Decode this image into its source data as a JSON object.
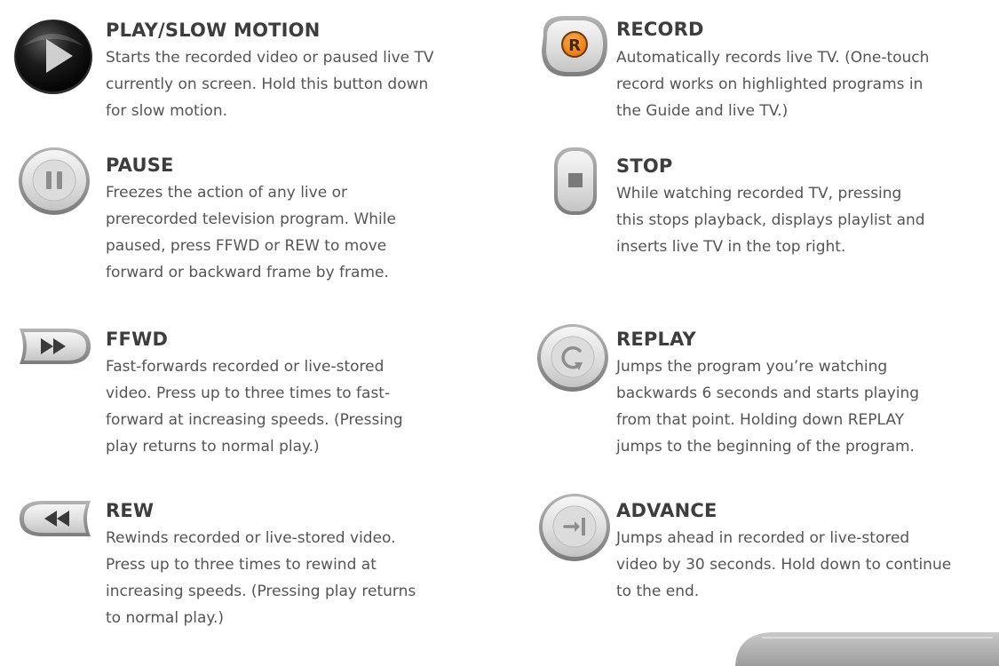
{
  "buttons": [
    {
      "title": "PLAY/SLOW MOTION",
      "icon": "play-icon",
      "lines": [
        "Starts the recorded video or paused live TV",
        "currently on screen. Hold this button down",
        "for slow motion."
      ]
    },
    {
      "title": "PAUSE",
      "icon": "pause-icon",
      "lines": [
        "Freezes the action of any live or",
        "prerecorded television program. While",
        "paused, press FFWD or REW to move",
        "forward or backward frame by frame."
      ]
    },
    {
      "title": "FFWD",
      "icon": "fast-forward-icon",
      "lines": [
        "Fast-forwards recorded or live-stored",
        "video. Press up to three times to fast-",
        "forward at increasing speeds. (Pressing",
        "play returns to normal play.)"
      ]
    },
    {
      "title": "REW",
      "icon": "rewind-icon",
      "lines": [
        "Rewinds recorded or live-stored video.",
        "Press up to three times to rewind at",
        "increasing speeds. (Pressing play returns",
        "to normal play.)"
      ]
    },
    {
      "title": "RECORD",
      "icon": "record-icon",
      "icon_letter": "R",
      "lines": [
        "Automatically records live TV. (One-touch",
        "record works on highlighted programs in",
        "the Guide and live TV.)"
      ]
    },
    {
      "title": "STOP",
      "icon": "stop-icon",
      "lines": [
        "While watching recorded TV, pressing",
        "this stops playback, displays playlist and",
        "inserts live TV in the top right."
      ]
    },
    {
      "title": "REPLAY",
      "icon": "replay-icon",
      "lines": [
        "Jumps the program you’re watching",
        "backwards 6 seconds and starts playing",
        "from that point. Holding down REPLAY",
        "jumps to the beginning of the program."
      ]
    },
    {
      "title": "ADVANCE",
      "icon": "advance-icon",
      "lines": [
        "Jumps ahead in recorded or live-stored",
        "video by 30 seconds. Hold down to continue",
        "to the end."
      ]
    }
  ],
  "colors": {
    "record_accent": "#f07f1a",
    "button_face": "#e4e4e4",
    "button_rim": "#9a9a9a",
    "glyph": "#8d8d8d"
  }
}
